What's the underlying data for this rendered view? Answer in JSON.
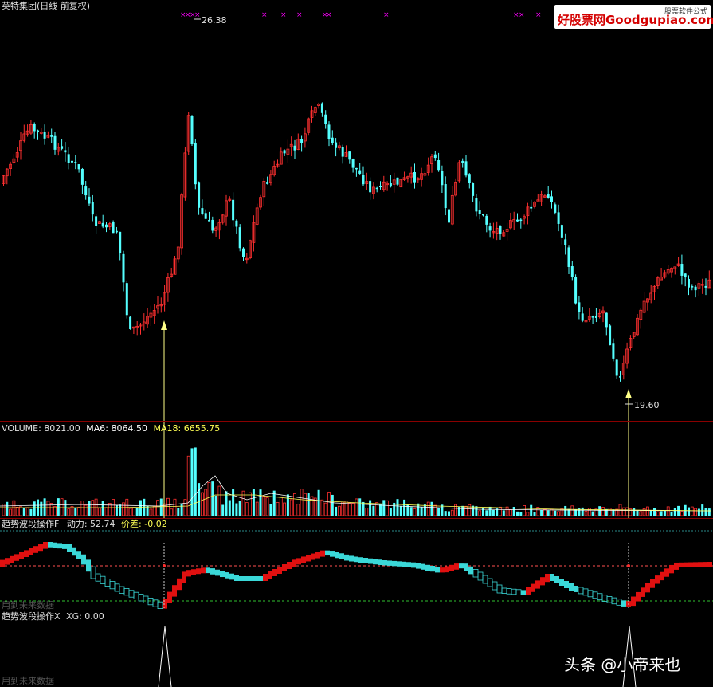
{
  "main_chart": {
    "title": "英特集团(日线 前复权)",
    "high_label": "26.38",
    "low_label": "19.60"
  },
  "logo": {
    "text": "好股票网Goodgupiao.com",
    "subtext": "股票软件公式"
  },
  "volume_panel": {
    "volume_label": "VOLUME: 8021.00",
    "ma6_label": "MA6: 8064.50",
    "ma18_label": "MA18: 6655.75"
  },
  "trend_panel": {
    "name": "趋势波段操作F",
    "power_label": "动力: 52.74",
    "diff_label": "价差: -0.02",
    "future_note": "用到未来数据"
  },
  "xg_panel": {
    "name": "趋势波段操作X",
    "xg_label": "XG: 0.00",
    "future_note": "用到未来数据"
  },
  "watermark": {
    "text": "头条 @小帝来也"
  },
  "colors": {
    "up": "#ff3030",
    "down": "#54ffff",
    "ma6": "#ffffff",
    "ma18": "#ffff54",
    "marker": "#ff00ff",
    "arrow": "#ffff88"
  },
  "icons": {
    "buy_arrow": "arrow-up-icon",
    "signal_mark": "cross-mark-icon"
  }
}
